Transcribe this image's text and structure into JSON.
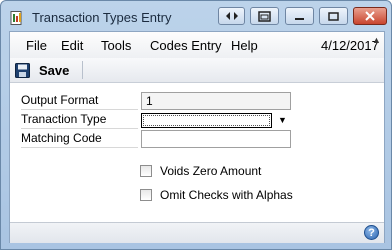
{
  "window": {
    "title": "Transaction Types Entry",
    "icons": {
      "app": "document-app-icon",
      "back": "left-right-arrows-icon",
      "restore": "window-restore-icon",
      "minimize": "minimize-icon",
      "maximize": "maximize-icon",
      "close": "close-icon"
    }
  },
  "menu": {
    "items": [
      "File",
      "Edit",
      "Tools",
      "Codes Entry",
      "Help"
    ],
    "date": "4/12/2017"
  },
  "toolbar": {
    "save_label": "Save",
    "save_icon": "floppy-disk-icon"
  },
  "form": {
    "output_format_label": "Output Format",
    "output_format_value": "1",
    "transaction_type_label": "Tranaction Type",
    "transaction_type_value": "",
    "matching_code_label": "Matching Code",
    "matching_code_value": "",
    "voids_zero_label": "Voids Zero Amount",
    "voids_zero_checked": false,
    "omit_checks_label": "Omit Checks with Alphas",
    "omit_checks_checked": false
  },
  "status": {
    "help_icon": "help-icon",
    "help_glyph": "?"
  }
}
